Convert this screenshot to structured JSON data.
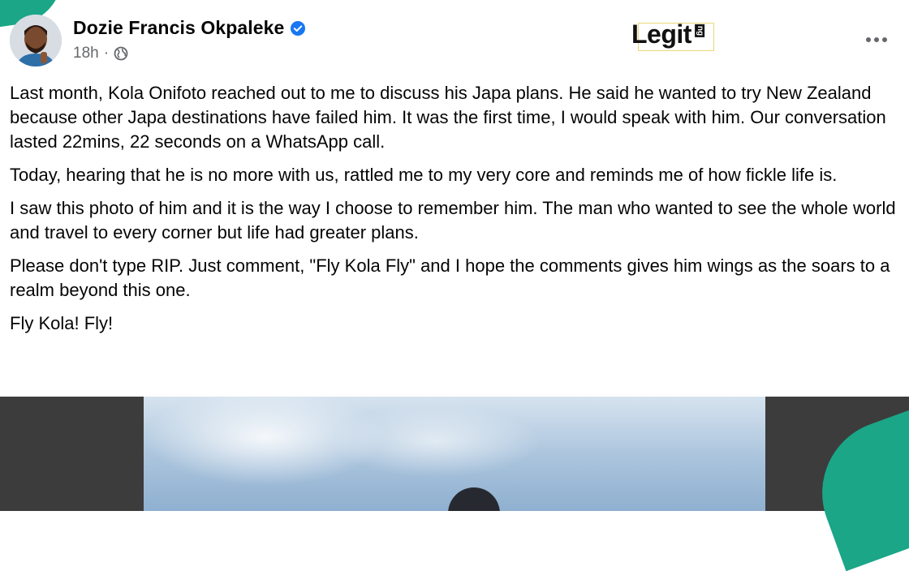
{
  "post": {
    "author": "Dozie Francis Okpaleke",
    "time": "18h",
    "separator": "·",
    "visibility_icon": "globe-icon",
    "verified_icon": "verified-badge-icon",
    "paragraphs": [
      "Last month, Kola Onifoto reached out to me to discuss his Japa plans. He said he wanted to try New Zealand because other Japa destinations have failed him. It was the first time, I would speak with him. Our conversation lasted 22mins, 22 seconds on a WhatsApp call.",
      "Today, hearing that he is no more with us, rattled me to my very core and reminds me of how fickle life is.",
      "I saw this photo of him and it is the way I choose to remember him. The man who wanted to see the whole world and travel to every corner but life had greater plans.",
      "Please don't type RIP. Just comment, \"Fly Kola Fly\" and I hope the comments gives him wings as the soars to a realm beyond this one.",
      "Fly Kola! Fly!"
    ]
  },
  "watermark": {
    "text": "Legit",
    "suffix": "ng"
  },
  "colors": {
    "brand_green": "#1aa687",
    "verified_blue": "#1877f2",
    "meta_gray": "#65676b",
    "media_bg": "#3c3c3c"
  }
}
